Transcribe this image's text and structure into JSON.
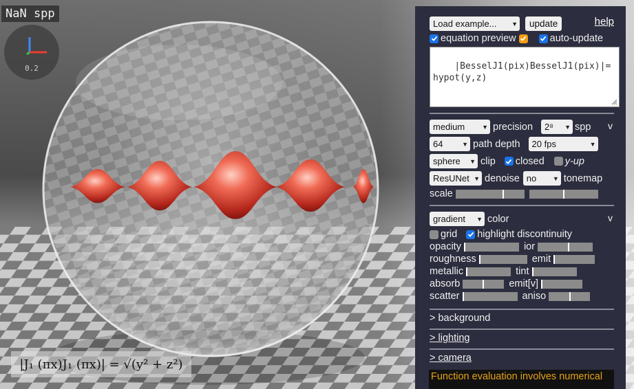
{
  "render": {
    "spp_counter": "NaN spp",
    "zoom_label": "0.2",
    "equation_preview": "|J₁ (πx)J₁ (πx)| = √(y² + z²)",
    "surface_color": "#e0443a"
  },
  "panel": {
    "example_select": "Load example...",
    "update_button": "update",
    "help_link": "help",
    "equation_preview_label": "equation preview",
    "equation_preview_checked": true,
    "latex_toggle_checked": true,
    "auto_update_label": "auto-update",
    "auto_update_checked": true,
    "equation_text": "|BesselJ1(pix)BesselJ1(pix)|=hypot(y,z)",
    "render_section": {
      "collapse_glyph": "v",
      "quality_select": "medium",
      "precision_label": "precision",
      "spp_select": "2⁸",
      "spp_label": "spp",
      "depth_select": "64",
      "path_depth_label": "path depth",
      "fps_select": "20 fps",
      "clip_select": "sphere",
      "clip_label": "clip",
      "closed_label": "closed",
      "closed_checked": true,
      "yup_label": "y-up",
      "yup_checked": false,
      "denoise_select": "ResUNet",
      "denoise_label": "denoise",
      "tonemap_select": "no",
      "tonemap_label": "tonemap",
      "scale_label": "scale",
      "scale_slider_1": 0.68,
      "scale_slider_2": 0.49
    },
    "color_section": {
      "collapse_glyph": "v",
      "color_select": "gradient",
      "color_label": "color",
      "grid_label": "grid",
      "grid_checked": false,
      "highlight_label": "highlight discontinuity",
      "highlight_checked": true,
      "opacity_label": "opacity",
      "opacity_value": 0.0,
      "ior_label": "ior",
      "ior_value": 0.55,
      "roughness_label": "roughness",
      "roughness_value": 0.0,
      "emit_label": "emit",
      "emit_value": 0.0,
      "metallic_label": "metallic",
      "metallic_value": 0.0,
      "tint_label": "tint",
      "tint_value": 0.0,
      "absorb_label": "absorb",
      "absorb_value": 0.48,
      "emitv_label": "emit[v]",
      "emitv_value": 0.0,
      "scatter_label": "scatter",
      "scatter_value": 0.0,
      "aniso_label": "aniso",
      "aniso_value": 0.5
    },
    "background_link": "> background",
    "lighting_link": "> lighting",
    "camera_link": "> camera",
    "notice_text": "Function evaluation involves numerical"
  }
}
